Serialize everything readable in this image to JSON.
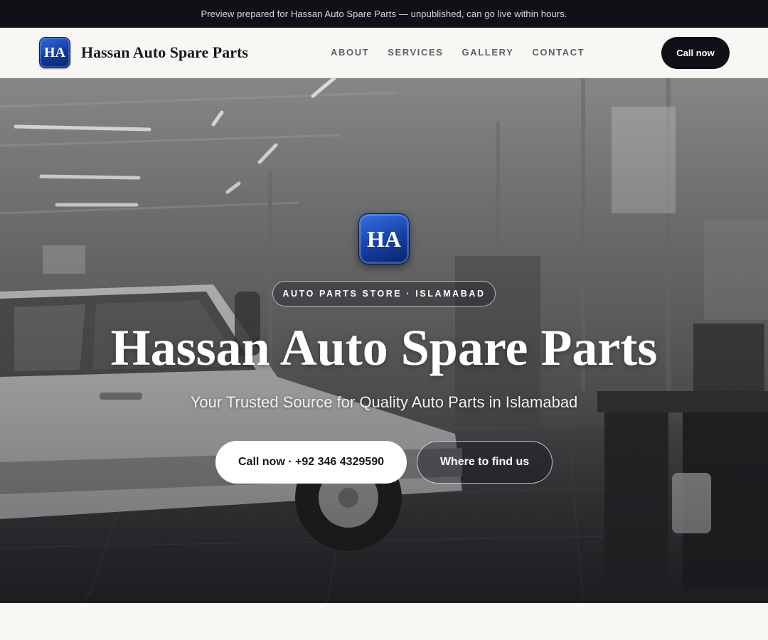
{
  "banner": {
    "text": "Preview prepared for Hassan Auto Spare Parts — unpublished, can go live within hours."
  },
  "header": {
    "logo_text": "HA",
    "brand_name": "Hassan Auto Spare Parts",
    "nav": [
      {
        "label": "ABOUT"
      },
      {
        "label": "SERVICES"
      },
      {
        "label": "GALLERY"
      },
      {
        "label": "CONTACT"
      }
    ],
    "cta_label": "Call now"
  },
  "hero": {
    "logo_text": "HA",
    "eyebrow": "AUTO PARTS STORE · ISLAMABAD",
    "title": "Hassan Auto Spare Parts",
    "subtitle": "Your Trusted Source for Quality Auto Parts in Islamabad",
    "primary_button": "Call now · +92 346 4329590",
    "secondary_button": "Where to find us",
    "background_image": "garage-workshop-photo (grayscale)"
  },
  "colors": {
    "topbar": "#0f1116",
    "page_bg": "#f8f7f3",
    "logo_blue": "#163fa3",
    "cta_dark": "#0f1116",
    "hero_text": "#ffffff"
  }
}
